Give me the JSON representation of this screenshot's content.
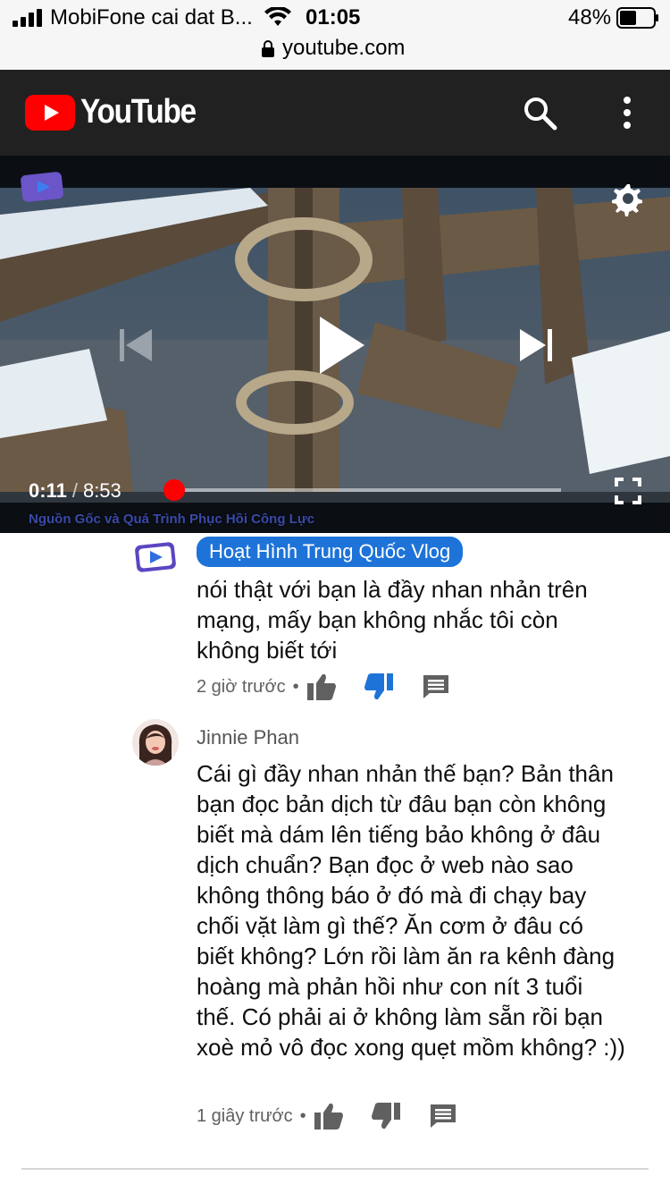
{
  "status_bar": {
    "carrier": "MobiFone cai dat B...",
    "time": "01:05",
    "battery": "48%",
    "url": "youtube.com"
  },
  "header": {
    "brand": "YouTube",
    "icons": [
      "youtube-logo-icon",
      "search-icon",
      "more-vert-icon"
    ]
  },
  "player": {
    "current_time": "0:11",
    "separator": "/",
    "duration": "8:53",
    "progress": 0.021,
    "watermark": "Nguồn Gốc và Quá Trình Phục Hồi Công Lực",
    "icons": [
      "settings-gear-icon",
      "previous-icon",
      "play-icon",
      "next-icon",
      "fullscreen-icon"
    ],
    "accent": "#ff0000"
  },
  "comments": [
    {
      "author": "Hoạt Hình Trung Quốc Vlog",
      "text": "nói thật với bạn là đầy nhan nhản trên mạng, mấy bạn không nhắc tôi còn không biết tới",
      "time": "2 giờ trước",
      "dislike_active": true
    },
    {
      "author": "Jinnie Phan",
      "text": "Cái gì đầy nhan nhản thế bạn? Bản thân bạn đọc bản dịch từ đâu bạn còn không biết mà dám lên tiếng bảo không ở đâu dịch chuẩn? Bạn đọc ở web nào sao không thông báo ở đó mà đi chạy bay chối vặt làm gì thế? Ăn cơm ở đâu có biết không? Lớn rồi làm ăn ra kênh đàng hoàng mà phản hồi như con nít 3 tuổi thế. Có phải ai ở không làm sẵn rồi bạn xoè mỏ vô đọc xong quẹt mồm không? :))",
      "time": "1 giây trước",
      "dislike_active": false
    }
  ],
  "colors": {
    "header_bg": "#212121",
    "badge_bg": "#1e73d8",
    "dislike_active": "#1e73d8",
    "icon_gray": "#606060"
  }
}
